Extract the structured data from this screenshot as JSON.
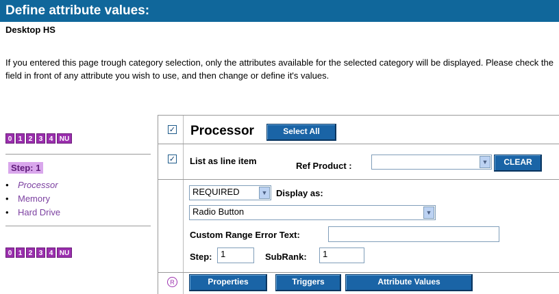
{
  "header": {
    "title": "Define attribute values:",
    "subtitle": "Desktop HS",
    "intro": "If you entered this page trough category selection, only the attributes available for the selected category will be displayed. Please check the field in front of any attribute you wish to use, and then change or define it's values."
  },
  "sidebar": {
    "step_buttons": [
      "0",
      "1",
      "2",
      "3",
      "4",
      "NU"
    ],
    "step_label": "Step: 1",
    "attributes": [
      "Processor",
      "Memory",
      "Hard Drive"
    ]
  },
  "main": {
    "attribute_title": "Processor",
    "select_all_label": "Select All",
    "list_as_line_item": "List as line item",
    "ref_product_label": "Ref Product :",
    "ref_product_value": "",
    "clear_label": "CLEAR",
    "required_value": "REQUIRED",
    "display_as_label": "Display as:",
    "display_as_value": "Radio Button",
    "custom_error_label": "Custom Range Error Text:",
    "custom_error_value": "",
    "step_label": "Step:",
    "step_value": "1",
    "subrank_label": "SubRank:",
    "subrank_value": "1",
    "radio_icon_glyph": "R",
    "buttons": [
      "Properties",
      "Triggers",
      "Attribute Values"
    ]
  },
  "colors": {
    "title_bar": "#10679b",
    "step_box": "#9b2fae",
    "button_blue": "#1a64a6"
  }
}
